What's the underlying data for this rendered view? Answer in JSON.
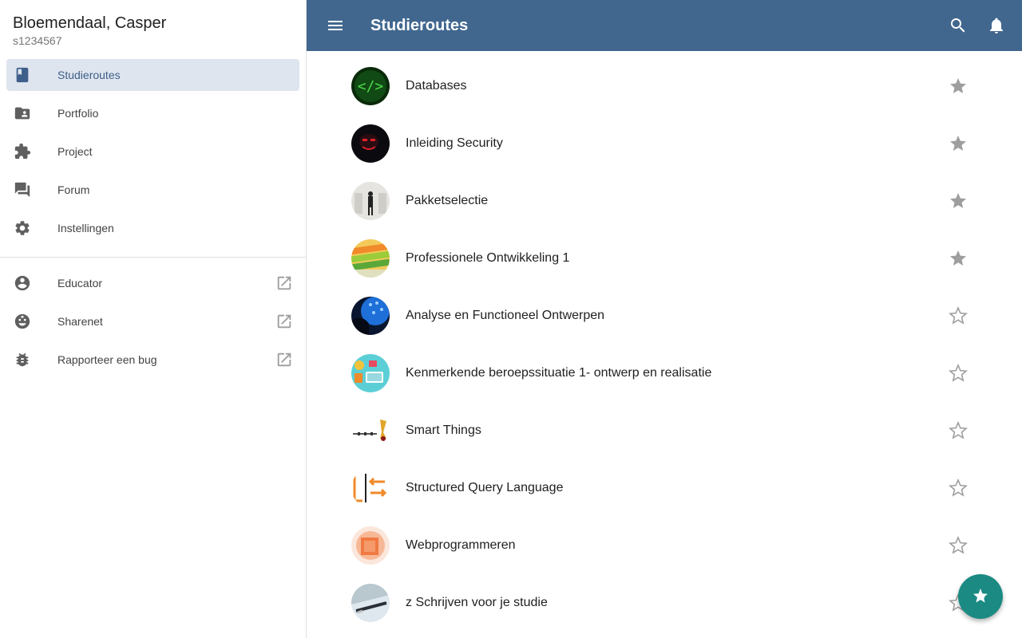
{
  "user": {
    "name": "Bloemendaal, Casper",
    "id": "s1234567"
  },
  "nav": [
    {
      "label": "Studieroutes",
      "icon": "book-icon",
      "active": true
    },
    {
      "label": "Portfolio",
      "icon": "folder-account-icon"
    },
    {
      "label": "Project",
      "icon": "puzzle-icon"
    },
    {
      "label": "Forum",
      "icon": "forum-icon"
    },
    {
      "label": "Instellingen",
      "icon": "gear-icon"
    }
  ],
  "external": [
    {
      "label": "Educator",
      "icon": "account-circle-icon"
    },
    {
      "label": "Sharenet",
      "icon": "face-icon"
    },
    {
      "label": "Rapporteer een bug",
      "icon": "bug-icon"
    }
  ],
  "appbar": {
    "title": "Studieroutes"
  },
  "routes": [
    {
      "title": "Databases",
      "favorite": true
    },
    {
      "title": "Inleiding Security",
      "favorite": true
    },
    {
      "title": "Pakketselectie",
      "favorite": true
    },
    {
      "title": "Professionele Ontwikkeling 1",
      "favorite": true
    },
    {
      "title": "Analyse en Functioneel Ontwerpen",
      "favorite": false
    },
    {
      "title": "Kenmerkende beroepssituatie 1- ontwerp en realisatie",
      "favorite": false
    },
    {
      "title": "Smart Things",
      "favorite": false
    },
    {
      "title": "Structured Query Language",
      "favorite": false
    },
    {
      "title": "Webprogrammeren",
      "favorite": false
    },
    {
      "title": "z Schrijven voor je studie",
      "favorite": false
    }
  ],
  "colors": {
    "appbar": "#41678f",
    "fab": "#1b8a83",
    "active_bg": "#dfe5ee",
    "star_filled": "#9e9e9e"
  }
}
